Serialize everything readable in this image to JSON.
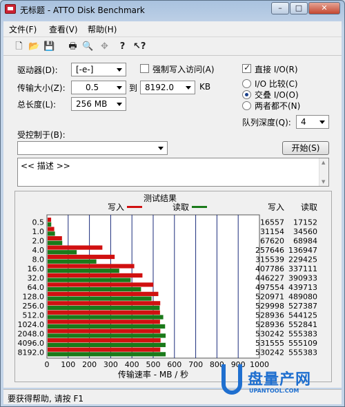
{
  "window": {
    "title": "无标题 - ATTO Disk Benchmark"
  },
  "menu": [
    "文件(F)",
    "查看(V)",
    "帮助(H)"
  ],
  "toolbar": [
    "new-file-icon",
    "open-folder-icon",
    "save-icon",
    "print-icon",
    "print-preview-icon",
    "move-icon",
    "help-icon",
    "context-help-icon"
  ],
  "controls": {
    "drive_label": "驱动器(D):",
    "drive_value": "[-e-]",
    "transfer_label": "传输大小(Z):",
    "transfer_from": "0.5",
    "to_label": "到",
    "transfer_to": "8192.0",
    "kb_label": "KB",
    "length_label": "总长度(L):",
    "length_value": "256 MB",
    "force_write_label": "强制写入访问(A)",
    "direct_io_label": "直接 I/O(R)",
    "io_compare_label": "I/O 比较(C)",
    "overlapped_io_label": "交叠 I/O(O)",
    "neither_label": "两者都不(N)",
    "queue_label": "队列深度(Q):",
    "queue_value": "4",
    "controlled_label": "受控制于(B):",
    "controlled_value": "",
    "start_button": "开始(S)",
    "description": "<< 描述 >>"
  },
  "chart_data": {
    "type": "bar",
    "title": "测试结果",
    "legend": [
      {
        "name": "写入",
        "color": "#d01010"
      },
      {
        "name": "读取",
        "color": "#1a7a1a"
      }
    ],
    "xlabel": "传输速率 - MB / 秒",
    "xlim": [
      0,
      1000
    ],
    "xticks": [
      "0",
      "100",
      "200",
      "300",
      "400",
      "500",
      "600",
      "700",
      "800",
      "900",
      "1000"
    ],
    "categories": [
      "0.5",
      "1.0",
      "2.0",
      "4.0",
      "8.0",
      "16.0",
      "32.0",
      "64.0",
      "128.0",
      "256.0",
      "512.0",
      "1024.0",
      "2048.0",
      "4096.0",
      "8192.0"
    ],
    "series": [
      {
        "name": "写入",
        "values": [
          16557,
          31154,
          67620,
          257646,
          315539,
          407786,
          446227,
          497554,
          520971,
          529998,
          528936,
          528936,
          530242,
          531555,
          530242
        ]
      },
      {
        "name": "读取",
        "values": [
          17152,
          34560,
          68984,
          136947,
          229425,
          337111,
          390933,
          439713,
          489080,
          527387,
          544125,
          552841,
          555383,
          555109,
          555383
        ]
      }
    ],
    "value_unit_divisor": 1000,
    "col_headers": [
      "写入",
      "读取"
    ]
  },
  "statusbar": {
    "text": "要获得帮助, 请按 F1"
  },
  "watermark": {
    "brand": "盘量产网",
    "site": "UPANTOOL.COM"
  }
}
